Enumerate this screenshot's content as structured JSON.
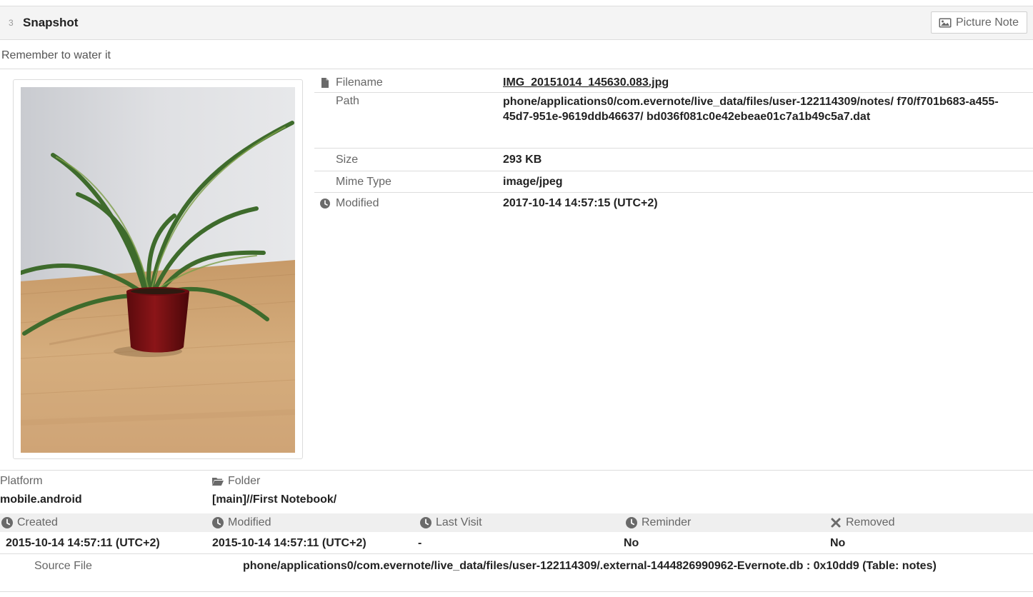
{
  "header": {
    "index": "3",
    "title": "Snapshot",
    "picture_note_label": "Picture Note"
  },
  "note_text": "Remember to water it",
  "image": {
    "alt": "photo of a plant in a red pot on a wooden table"
  },
  "properties": {
    "filename_label": "Filename",
    "filename_value": "IMG_20151014_145630.083.jpg",
    "path_label": "Path",
    "path_value": "phone/applications0/com.evernote/live_data/files/user-122114309/notes/ f70/f701b683-a455-45d7-951e-9619ddb46637/ bd036f081c0e42ebeae01c7a1b49c5a7.dat",
    "size_label": "Size",
    "size_value": "293 KB",
    "mime_label": "Mime Type",
    "mime_value": "image/jpeg",
    "modified_label": "Modified",
    "modified_value": "2017-10-14 14:57:15 (UTC+2)"
  },
  "meta": {
    "platform_label": "Platform",
    "platform_value": "mobile.android",
    "folder_label": "Folder",
    "folder_value": "[main]//First Notebook/",
    "created_label": "Created",
    "created_value": "2015-10-14 14:57:11 (UTC+2)",
    "modified_label": "Modified",
    "modified_value": "2015-10-14 14:57:11 (UTC+2)",
    "last_visit_label": "Last Visit",
    "last_visit_value": "-",
    "reminder_label": "Reminder",
    "reminder_value": "No",
    "removed_label": "Removed",
    "removed_value": "No"
  },
  "source": {
    "label": "Source File",
    "value": "phone/applications0/com.evernote/live_data/files/user-122114309/.external-1444826990962-Evernote.db : 0x10dd9 (Table: notes)"
  },
  "colors": {
    "icon": "#6a6a6a",
    "border": "#dddddd",
    "header_bg": "#f4f4f4",
    "pot": "#7a0f12"
  }
}
